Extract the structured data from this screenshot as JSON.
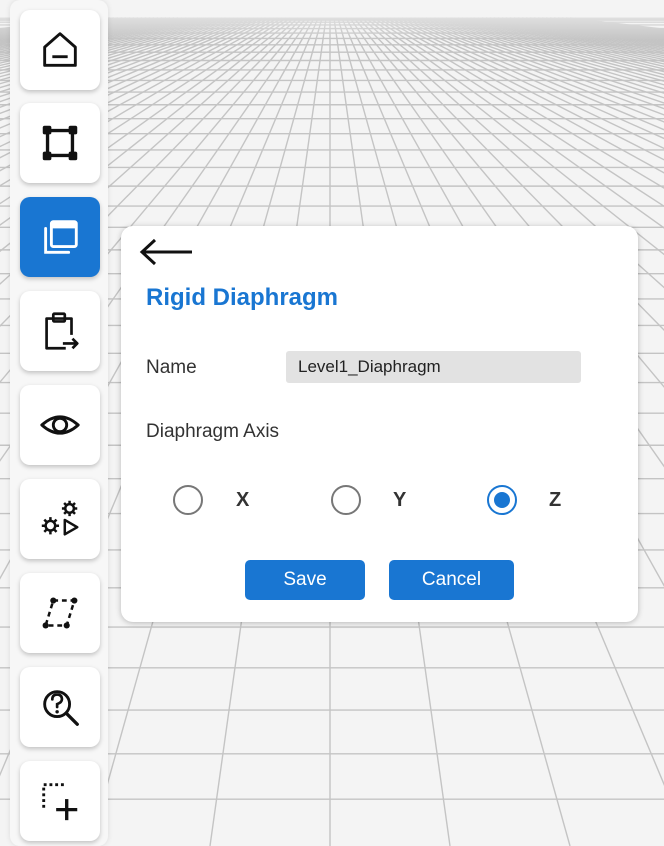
{
  "toolbar": {
    "items": [
      {
        "icon": "home-icon"
      },
      {
        "icon": "frame-icon"
      },
      {
        "icon": "layers-icon",
        "active": true
      },
      {
        "icon": "clipboard-export-icon"
      },
      {
        "icon": "eye-icon"
      },
      {
        "icon": "gears-play-icon"
      },
      {
        "icon": "parallelogram-nodes-icon"
      },
      {
        "icon": "question-search-icon"
      },
      {
        "icon": "selection-add-icon"
      }
    ]
  },
  "panel": {
    "back_icon": "arrow-left-icon",
    "title": "Rigid Diaphragm",
    "name_label": "Name",
    "name_value": "Level1_Diaphragm",
    "axis_label": "Diaphragm Axis",
    "axis_options": [
      "X",
      "Y",
      "Z"
    ],
    "axis_selected": "Z",
    "save_label": "Save",
    "cancel_label": "Cancel"
  },
  "colors": {
    "accent": "#1976d2",
    "panel_bg": "#ffffff",
    "input_bg": "#e2e2e2",
    "grid_line": "#c4c4c4",
    "viewport_bg": "#f4f4f4"
  }
}
